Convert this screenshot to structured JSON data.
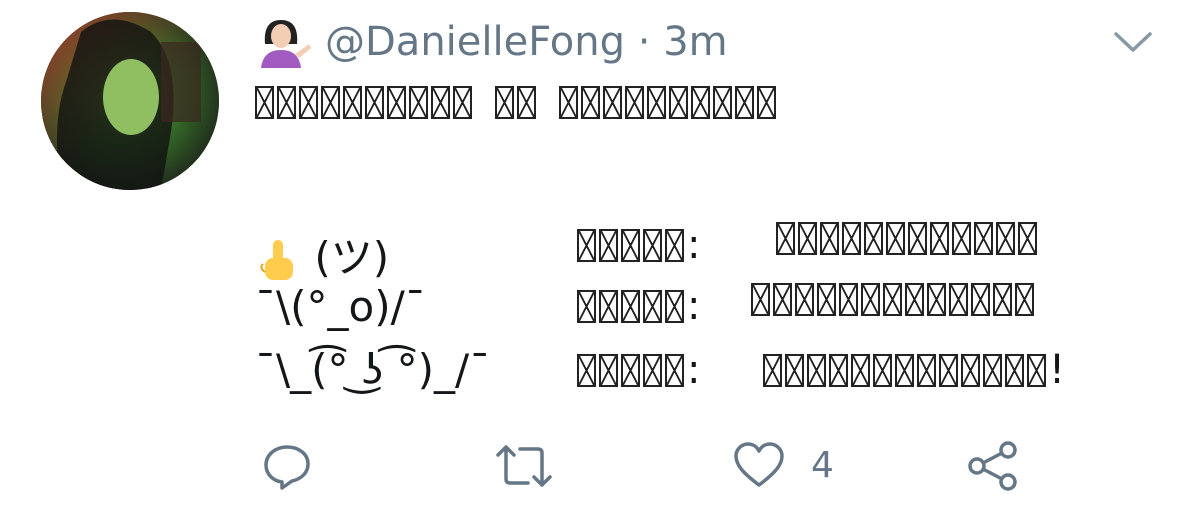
{
  "tweet": {
    "handle": "@DanielleFong",
    "separator": "·",
    "time": "3m",
    "line1_groups": [
      10,
      2,
      10
    ],
    "rows": [
      {
        "face": "(ツ)",
        "label_boxes": 5,
        "colon": ":",
        "value_boxes": 12,
        "suffix": ""
      },
      {
        "face": "¯\\(°_o)/¯",
        "label_boxes": 5,
        "colon": ":",
        "value_boxes": 13,
        "suffix": ""
      },
      {
        "face": "¯\\_(͡° ͜ʖ ͡°)_/¯",
        "label_boxes": 5,
        "colon": ":",
        "value_boxes": 13,
        "suffix": "!"
      }
    ],
    "first_row_prefix_icon": "pointing-up-emoji",
    "header_icon": "woman-tipping-hand-emoji"
  },
  "actions": {
    "reply_icon": "reply-icon",
    "retweet_icon": "retweet-icon",
    "like_icon": "heart-icon",
    "like_count": "4",
    "share_icon": "share-icon"
  },
  "colors": {
    "secondary_text": "#657786",
    "primary_text": "#14171a"
  }
}
